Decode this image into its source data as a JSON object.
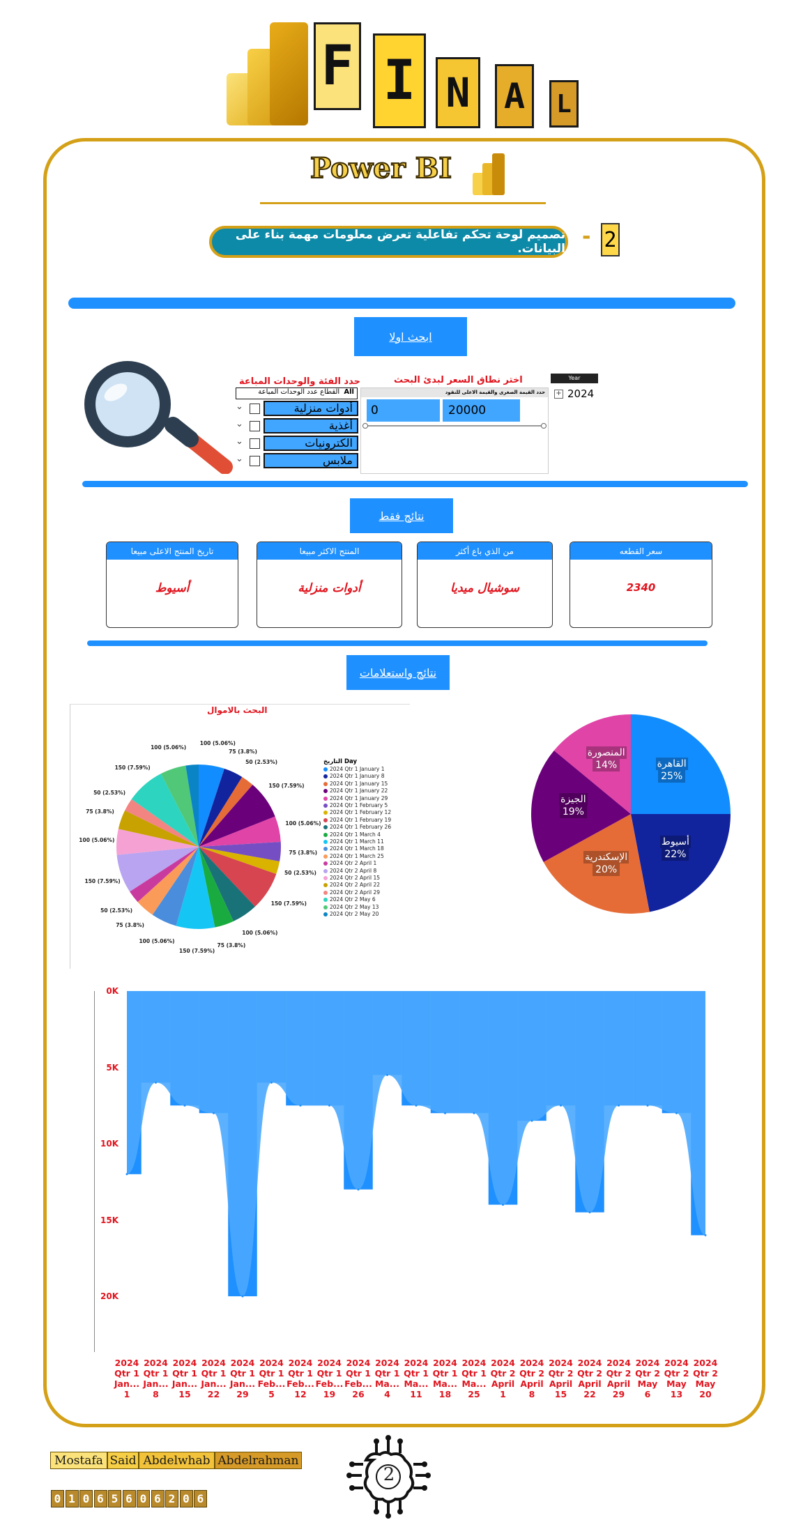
{
  "header": {
    "final_letters": [
      "F",
      "I",
      "N",
      "A",
      "L"
    ],
    "powerbi_title": "Power BI"
  },
  "task": {
    "number": "2",
    "dash": "-",
    "description": "تصميم لوحة تحكم تفاعلية تعرض معلومات مهمة بناء على البيانات."
  },
  "search_section": {
    "button_label": "ابحث اولا",
    "category_title": "حدد الفئة والوحدات المباعة",
    "category_header_all": "All",
    "category_header_label": "القطاع عدد الوحدات المباعة",
    "categories": [
      "أدوات منزلية",
      "أغذية",
      "الكترونيات",
      "ملابس"
    ],
    "price_title": "اختر نطاق السعر لبدئ البحث",
    "price_subtitle": "حدد القيمة الصغرى والقيمة الاعلى للنقود",
    "price_min": "0",
    "price_max": "20000",
    "year_header": "Year",
    "year_value": "2024",
    "year_expand": "+"
  },
  "results_section": {
    "button_label": "نتائج فقط",
    "cards": [
      {
        "title": "تاريخ المنتج الاعلى مبيعا",
        "value": "أسيوط"
      },
      {
        "title": "المنتج الاكثر مبيعا",
        "value": "أدوات منزلية"
      },
      {
        "title": "من الذي باع أكثر",
        "value": "سوشيال ميديا"
      },
      {
        "title": "سعر القطعه",
        "value": "2340"
      }
    ]
  },
  "queries_section": {
    "button_label": "نتائج واستعلامات"
  },
  "pie_small": {
    "title": "البحث بالاموال",
    "legend_title": "التاريخ Day",
    "legend": [
      "2024 Qtr 1 January 1",
      "2024 Qtr 1 January 8",
      "2024 Qtr 1 January 15",
      "2024 Qtr 1 January 22",
      "2024 Qtr 1 January 29",
      "2024 Qtr 1 February 5",
      "2024 Qtr 1 February 12",
      "2024 Qtr 1 February 19",
      "2024 Qtr 1 February 26",
      "2024 Qtr 1 March 4",
      "2024 Qtr 1 March 11",
      "2024 Qtr 1 March 18",
      "2024 Qtr 1 March 25",
      "2024 Qtr 2 April 1",
      "2024 Qtr 2 April 8",
      "2024 Qtr 2 April 15",
      "2024 Qtr 2 April 22",
      "2024 Qtr 2 April 29",
      "2024 Qtr 2 May 6",
      "2024 Qtr 2 May 13",
      "2024 Qtr 2 May 20"
    ],
    "slice_labels": [
      "100 (5.06%)",
      "75 (3.8%)",
      "50 (2.53%)",
      "150 (7.59%)",
      "100 (5.06%)",
      "75 (3.8%)",
      "50 (2.53%)",
      "150 (7.59%)",
      "100 (5.06%)",
      "75 (3.8%)",
      "150 (7.59%)",
      "100 (5.06%)",
      "75 (3.8%)",
      "50 (2.53%)",
      "150 (7.59%)",
      "100 (5.06%)",
      "75 (3.8%)",
      "50 (2.53%)",
      "150 (7.59%)",
      "100 (5.06%)"
    ]
  },
  "chart_data": [
    {
      "type": "pie",
      "title": "البحث بالاموال",
      "legend_title": "التاريخ Day",
      "legend_position": "right",
      "categories": [
        "2024 Qtr 1 January 1",
        "2024 Qtr 1 January 8",
        "2024 Qtr 1 January 15",
        "2024 Qtr 1 January 22",
        "2024 Qtr 1 January 29",
        "2024 Qtr 1 February 5",
        "2024 Qtr 1 February 12",
        "2024 Qtr 1 February 19",
        "2024 Qtr 1 February 26",
        "2024 Qtr 1 March 4",
        "2024 Qtr 1 March 11",
        "2024 Qtr 1 March 18",
        "2024 Qtr 1 March 25",
        "2024 Qtr 2 April 1",
        "2024 Qtr 2 April 8",
        "2024 Qtr 2 April 15",
        "2024 Qtr 2 April 22",
        "2024 Qtr 2 April 29",
        "2024 Qtr 2 May 6",
        "2024 Qtr 2 May 13",
        "2024 Qtr 2 May 20"
      ],
      "values": [
        100,
        75,
        50,
        150,
        100,
        75,
        50,
        150,
        100,
        75,
        150,
        100,
        75,
        50,
        150,
        100,
        75,
        50,
        150,
        100,
        50
      ],
      "colors": [
        "#118dff",
        "#12239e",
        "#e66c37",
        "#6b007b",
        "#e044a7",
        "#744ec2",
        "#d9b300",
        "#d64550",
        "#197278",
        "#1aab40",
        "#15c6f4",
        "#4a8ddc",
        "#fa9b5a",
        "#c93a9f",
        "#b8a4f0",
        "#f5a1d4",
        "#c7a200",
        "#f28482",
        "#2dd4bf",
        "#50c878",
        "#0b84c5"
      ]
    },
    {
      "type": "pie",
      "categories": [
        "القاهرة",
        "أسيوط",
        "الإسكندرية",
        "الجيزة",
        "المنصورة"
      ],
      "values": [
        25,
        22,
        20,
        19,
        14
      ],
      "labels": [
        "25%",
        "22%",
        "20%",
        "19%",
        "14%"
      ],
      "colors": [
        "#118dff",
        "#12239e",
        "#e66c37",
        "#6b007b",
        "#e044a7"
      ]
    },
    {
      "type": "area",
      "x": [
        "2024 Qtr 1 January 1",
        "2024 Qtr 1 January 8",
        "2024 Qtr 1 January 15",
        "2024 Qtr 1 January 22",
        "2024 Qtr 1 January 29",
        "2024 Qtr 1 February 5",
        "2024 Qtr 1 February 12",
        "2024 Qtr 1 February 19",
        "2024 Qtr 1 February 26",
        "2024 Qtr 1 March 4",
        "2024 Qtr 1 March 11",
        "2024 Qtr 1 March 18",
        "2024 Qtr 1 March 25",
        "2024 Qtr 2 April 1",
        "2024 Qtr 2 April 8",
        "2024 Qtr 2 April 15",
        "2024 Qtr 2 April 22",
        "2024 Qtr 2 April 29",
        "2024 Qtr 2 May 6",
        "2024 Qtr 2 May 13",
        "2024 Qtr 2 May 20"
      ],
      "x_tick_lines": [
        [
          "2024",
          "Qtr 1",
          "Jan...",
          "1"
        ],
        [
          "2024",
          "Qtr 1",
          "Jan...",
          "8"
        ],
        [
          "2024",
          "Qtr 1",
          "Jan...",
          "15"
        ],
        [
          "2024",
          "Qtr 1",
          "Jan...",
          "22"
        ],
        [
          "2024",
          "Qtr 1",
          "Jan...",
          "29"
        ],
        [
          "2024",
          "Qtr 1",
          "Feb...",
          "5"
        ],
        [
          "2024",
          "Qtr 1",
          "Feb...",
          "12"
        ],
        [
          "2024",
          "Qtr 1",
          "Feb...",
          "19"
        ],
        [
          "2024",
          "Qtr 1",
          "Feb...",
          "26"
        ],
        [
          "2024",
          "Qtr 1",
          "Ma...",
          "4"
        ],
        [
          "2024",
          "Qtr 1",
          "Ma...",
          "11"
        ],
        [
          "2024",
          "Qtr 1",
          "Ma...",
          "18"
        ],
        [
          "2024",
          "Qtr 1",
          "Ma...",
          "25"
        ],
        [
          "2024",
          "Qtr 2",
          "April",
          "1"
        ],
        [
          "2024",
          "Qtr 2",
          "April",
          "8"
        ],
        [
          "2024",
          "Qtr 2",
          "April",
          "15"
        ],
        [
          "2024",
          "Qtr 2",
          "April",
          "22"
        ],
        [
          "2024",
          "Qtr 2",
          "April",
          "29"
        ],
        [
          "2024",
          "Qtr 2",
          "May",
          "6"
        ],
        [
          "2024",
          "Qtr 2",
          "May",
          "13"
        ],
        [
          "2024",
          "Qtr 2",
          "May",
          "20"
        ]
      ],
      "values": [
        12000,
        6000,
        7500,
        8000,
        20000,
        6000,
        7500,
        7500,
        13000,
        5500,
        7500,
        8000,
        8000,
        14000,
        8500,
        7500,
        14500,
        7500,
        7500,
        8000,
        16000
      ],
      "y_ticks": [
        "0K",
        "5K",
        "10K",
        "15K",
        "20K"
      ],
      "ylim": [
        0,
        20000
      ],
      "y_inverted": true,
      "color": "#1e90ff"
    }
  ],
  "footer": {
    "names": [
      "Mostafa",
      "Said",
      "Abdelwhab",
      "Abdelrahman"
    ],
    "phone_digits": [
      "0",
      "1",
      "0",
      "6",
      "5",
      "6",
      "0",
      "6",
      "2",
      "0",
      "6"
    ],
    "brain_number": "2"
  }
}
